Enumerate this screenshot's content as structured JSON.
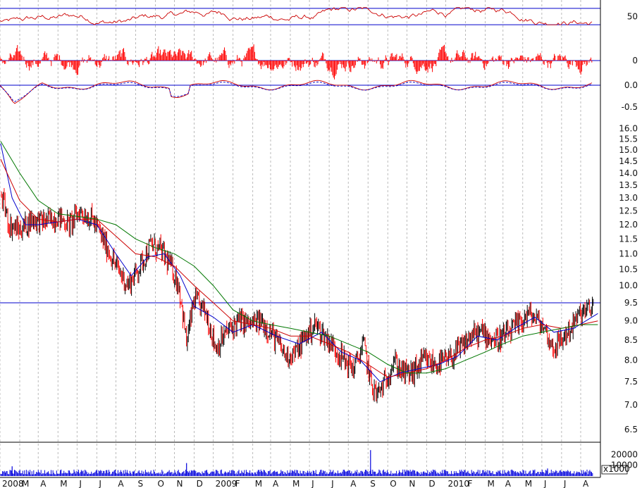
{
  "chart_data": [
    {
      "type": "line",
      "panel": "oscillator-top",
      "series": [
        {
          "color": "#cc0000"
        }
      ],
      "y_ticks": [
        {
          "value": 50,
          "label": "50"
        }
      ],
      "reference_lines": [
        70,
        30
      ],
      "ylim": [
        20,
        80
      ]
    },
    {
      "type": "bar",
      "panel": "histogram",
      "series": [
        {
          "color": "#ff0000"
        }
      ],
      "y_ticks": [
        {
          "value": 0,
          "label": "0"
        }
      ],
      "reference_lines": [
        0
      ],
      "ylim": [
        -1,
        1
      ]
    },
    {
      "type": "line",
      "panel": "macd",
      "series": [
        {
          "color": "#cc0000",
          "style": "solid"
        },
        {
          "color": "#0000cc",
          "style": "dashed"
        }
      ],
      "y_ticks": [
        {
          "value": 0.0,
          "label": "0.0"
        },
        {
          "value": -0.5,
          "label": "-0.5"
        }
      ],
      "reference_lines": [
        0.0
      ],
      "ylim": [
        -0.65,
        0.15
      ]
    },
    {
      "type": "candlestick",
      "panel": "price",
      "y_scale": "log",
      "ylim": [
        6.3,
        16.6
      ],
      "y_ticks": [
        {
          "value": 16.0,
          "label": "16.0"
        },
        {
          "value": 15.5,
          "label": "15.5"
        },
        {
          "value": 15.0,
          "label": "15.0"
        },
        {
          "value": 14.5,
          "label": "14.5"
        },
        {
          "value": 14.0,
          "label": "14.0"
        },
        {
          "value": 13.5,
          "label": "13.5"
        },
        {
          "value": 13.0,
          "label": "13.0"
        },
        {
          "value": 12.5,
          "label": "12.5"
        },
        {
          "value": 12.0,
          "label": "12.0"
        },
        {
          "value": 11.5,
          "label": "11.5"
        },
        {
          "value": 11.0,
          "label": "11.0"
        },
        {
          "value": 10.5,
          "label": "10.5"
        },
        {
          "value": 10.0,
          "label": "10.0"
        },
        {
          "value": 9.5,
          "label": "9.5"
        },
        {
          "value": 9.0,
          "label": "9.0"
        },
        {
          "value": 8.5,
          "label": "8.5"
        },
        {
          "value": 8.0,
          "label": "8.0"
        },
        {
          "value": 7.5,
          "label": "7.5"
        },
        {
          "value": 7.0,
          "label": "7.0"
        },
        {
          "value": 6.5,
          "label": "6.5"
        }
      ],
      "reference_lines": [
        9.5
      ],
      "price_path": [
        [
          "2008-01-02",
          13.2
        ],
        [
          "2008-01-15",
          12.0
        ],
        [
          "2008-02-01",
          11.8
        ],
        [
          "2008-02-20",
          12.2
        ],
        [
          "2008-03-10",
          12.1
        ],
        [
          "2008-04-01",
          12.3
        ],
        [
          "2008-04-20",
          12.0
        ],
        [
          "2008-05-05",
          12.5
        ],
        [
          "2008-05-25",
          12.2
        ],
        [
          "2008-06-15",
          11.3
        ],
        [
          "2008-07-01",
          10.6
        ],
        [
          "2008-07-20",
          10.0
        ],
        [
          "2008-08-05",
          10.5
        ],
        [
          "2008-08-25",
          11.3
        ],
        [
          "2008-09-10",
          11.1
        ],
        [
          "2008-09-25",
          10.6
        ],
        [
          "2008-10-08",
          10.0
        ],
        [
          "2008-10-20",
          8.4
        ],
        [
          "2008-11-01",
          9.6
        ],
        [
          "2008-11-20",
          9.2
        ],
        [
          "2008-12-05",
          8.3
        ],
        [
          "2008-12-22",
          8.7
        ],
        [
          "2009-01-10",
          9.0
        ],
        [
          "2009-01-28",
          8.9
        ],
        [
          "2009-02-15",
          9.0
        ],
        [
          "2009-03-05",
          8.6
        ],
        [
          "2009-03-25",
          8.1
        ],
        [
          "2009-04-10",
          8.2
        ],
        [
          "2009-04-25",
          8.6
        ],
        [
          "2009-05-10",
          8.9
        ],
        [
          "2009-05-25",
          8.6
        ],
        [
          "2009-06-10",
          8.3
        ],
        [
          "2009-06-25",
          8.0
        ],
        [
          "2009-07-10",
          7.8
        ],
        [
          "2009-07-25",
          8.4
        ],
        [
          "2009-08-05",
          7.5
        ],
        [
          "2009-08-15",
          7.2
        ],
        [
          "2009-08-28",
          7.5
        ],
        [
          "2009-09-10",
          8.0
        ],
        [
          "2009-09-25",
          7.7
        ],
        [
          "2009-10-10",
          7.7
        ],
        [
          "2009-10-28",
          8.0
        ],
        [
          "2009-11-15",
          7.9
        ],
        [
          "2009-12-05",
          8.0
        ],
        [
          "2009-12-25",
          8.3
        ],
        [
          "2010-01-10",
          8.6
        ],
        [
          "2010-01-28",
          8.7
        ],
        [
          "2010-02-15",
          8.5
        ],
        [
          "2010-03-05",
          8.6
        ],
        [
          "2010-03-25",
          8.9
        ],
        [
          "2010-04-10",
          9.2
        ],
        [
          "2010-04-25",
          9.0
        ],
        [
          "2010-05-05",
          8.8
        ],
        [
          "2010-05-18",
          8.3
        ],
        [
          "2010-06-01",
          8.5
        ],
        [
          "2010-06-15",
          8.8
        ],
        [
          "2010-07-01",
          9.2
        ],
        [
          "2010-07-15",
          9.3
        ],
        [
          "2010-07-28",
          9.6
        ]
      ],
      "moving_averages": [
        {
          "color": "#0000cc",
          "points": [
            [
              "2008-01-02",
              15.3
            ],
            [
              "2008-01-20",
              13.0
            ],
            [
              "2008-02-10",
              12.0
            ],
            [
              "2008-03-01",
              12.0
            ],
            [
              "2008-04-01",
              12.1
            ],
            [
              "2008-05-01",
              12.2
            ],
            [
              "2008-06-01",
              12.0
            ],
            [
              "2008-07-01",
              11.0
            ],
            [
              "2008-07-25",
              10.3
            ],
            [
              "2008-08-20",
              10.9
            ],
            [
              "2008-09-15",
              11.0
            ],
            [
              "2008-10-10",
              10.3
            ],
            [
              "2008-11-01",
              9.4
            ],
            [
              "2008-12-01",
              9.1
            ],
            [
              "2009-01-01",
              8.7
            ],
            [
              "2009-02-01",
              8.9
            ],
            [
              "2009-03-10",
              8.6
            ],
            [
              "2009-04-15",
              8.4
            ],
            [
              "2009-05-20",
              8.7
            ],
            [
              "2009-06-20",
              8.2
            ],
            [
              "2009-07-20",
              8.0
            ],
            [
              "2009-08-20",
              7.5
            ],
            [
              "2009-09-20",
              7.7
            ],
            [
              "2009-10-20",
              7.8
            ],
            [
              "2009-11-20",
              7.9
            ],
            [
              "2009-12-20",
              8.1
            ],
            [
              "2010-01-20",
              8.6
            ],
            [
              "2010-02-20",
              8.5
            ],
            [
              "2010-03-20",
              8.8
            ],
            [
              "2010-04-20",
              9.1
            ],
            [
              "2010-05-20",
              8.7
            ],
            [
              "2010-06-20",
              8.8
            ],
            [
              "2010-07-28",
              9.2
            ]
          ]
        },
        {
          "color": "#cc0000",
          "points": [
            [
              "2008-01-02",
              14.6
            ],
            [
              "2008-02-01",
              12.9
            ],
            [
              "2008-03-01",
              12.2
            ],
            [
              "2008-04-01",
              12.1
            ],
            [
              "2008-05-01",
              12.2
            ],
            [
              "2008-06-01",
              12.2
            ],
            [
              "2008-07-01",
              11.6
            ],
            [
              "2008-08-01",
              11.0
            ],
            [
              "2008-09-01",
              10.9
            ],
            [
              "2008-10-01",
              10.6
            ],
            [
              "2008-11-01",
              10.0
            ],
            [
              "2008-12-01",
              9.5
            ],
            [
              "2009-01-01",
              9.0
            ],
            [
              "2009-02-01",
              8.9
            ],
            [
              "2009-03-01",
              8.8
            ],
            [
              "2009-04-01",
              8.6
            ],
            [
              "2009-05-01",
              8.6
            ],
            [
              "2009-06-01",
              8.4
            ],
            [
              "2009-07-01",
              8.2
            ],
            [
              "2009-08-01",
              7.9
            ],
            [
              "2009-09-01",
              7.6
            ],
            [
              "2009-10-01",
              7.7
            ],
            [
              "2009-11-01",
              7.8
            ],
            [
              "2009-12-01",
              8.0
            ],
            [
              "2010-01-01",
              8.3
            ],
            [
              "2010-02-01",
              8.5
            ],
            [
              "2010-03-01",
              8.6
            ],
            [
              "2010-04-01",
              8.8
            ],
            [
              "2010-05-01",
              8.9
            ],
            [
              "2010-06-01",
              8.8
            ],
            [
              "2010-07-01",
              8.9
            ],
            [
              "2010-07-28",
              9.0
            ]
          ]
        },
        {
          "color": "#007700",
          "points": [
            [
              "2008-01-02",
              15.4
            ],
            [
              "2008-02-01",
              14.0
            ],
            [
              "2008-03-01",
              12.9
            ],
            [
              "2008-04-01",
              12.4
            ],
            [
              "2008-05-01",
              12.3
            ],
            [
              "2008-06-01",
              12.2
            ],
            [
              "2008-07-01",
              12.0
            ],
            [
              "2008-08-01",
              11.5
            ],
            [
              "2008-09-01",
              11.2
            ],
            [
              "2008-10-01",
              11.0
            ],
            [
              "2008-11-01",
              10.6
            ],
            [
              "2008-12-01",
              10.0
            ],
            [
              "2009-01-01",
              9.3
            ],
            [
              "2009-02-01",
              9.0
            ],
            [
              "2009-03-01",
              8.9
            ],
            [
              "2009-04-01",
              8.8
            ],
            [
              "2009-05-01",
              8.7
            ],
            [
              "2009-06-01",
              8.6
            ],
            [
              "2009-07-01",
              8.4
            ],
            [
              "2009-08-01",
              8.2
            ],
            [
              "2009-09-01",
              7.9
            ],
            [
              "2009-10-01",
              7.7
            ],
            [
              "2009-11-01",
              7.7
            ],
            [
              "2009-12-01",
              7.8
            ],
            [
              "2010-01-01",
              8.0
            ],
            [
              "2010-02-01",
              8.2
            ],
            [
              "2010-03-01",
              8.4
            ],
            [
              "2010-04-01",
              8.6
            ],
            [
              "2010-05-01",
              8.7
            ],
            [
              "2010-06-01",
              8.8
            ],
            [
              "2010-07-01",
              8.9
            ],
            [
              "2010-07-28",
              8.9
            ]
          ]
        }
      ]
    },
    {
      "type": "bar",
      "panel": "volume",
      "series": [
        {
          "color": "#0000dd"
        }
      ],
      "y_ticks": [
        {
          "value": 20000,
          "label": "20000"
        },
        {
          "value": 10000,
          "label": "10000"
        }
      ],
      "y_unit": "x1000",
      "ylim": [
        0,
        30000
      ],
      "spikes": [
        [
          "2008-10-20",
          12000
        ],
        [
          "2009-08-05",
          24000
        ],
        [
          "2008-01-20",
          9000
        ],
        [
          "2010-05-10",
          7000
        ]
      ]
    }
  ],
  "x_axis": {
    "start": "2008-01-01",
    "end": "2010-08-01",
    "month_labels": [
      "2008",
      "M",
      "A",
      "M",
      "J",
      "J",
      "A",
      "S",
      "O",
      "N",
      "D",
      "2009",
      "F",
      "M",
      "A",
      "M",
      "J",
      "J",
      "A",
      "S",
      "O",
      "N",
      "D",
      "2010",
      "F",
      "M",
      "A",
      "M",
      "J",
      "J",
      "A"
    ]
  },
  "colors": {
    "grid": "#aaaaaa",
    "reference": "#0000cc",
    "up_candle": "#000000",
    "down_candle": "#ff0000"
  }
}
